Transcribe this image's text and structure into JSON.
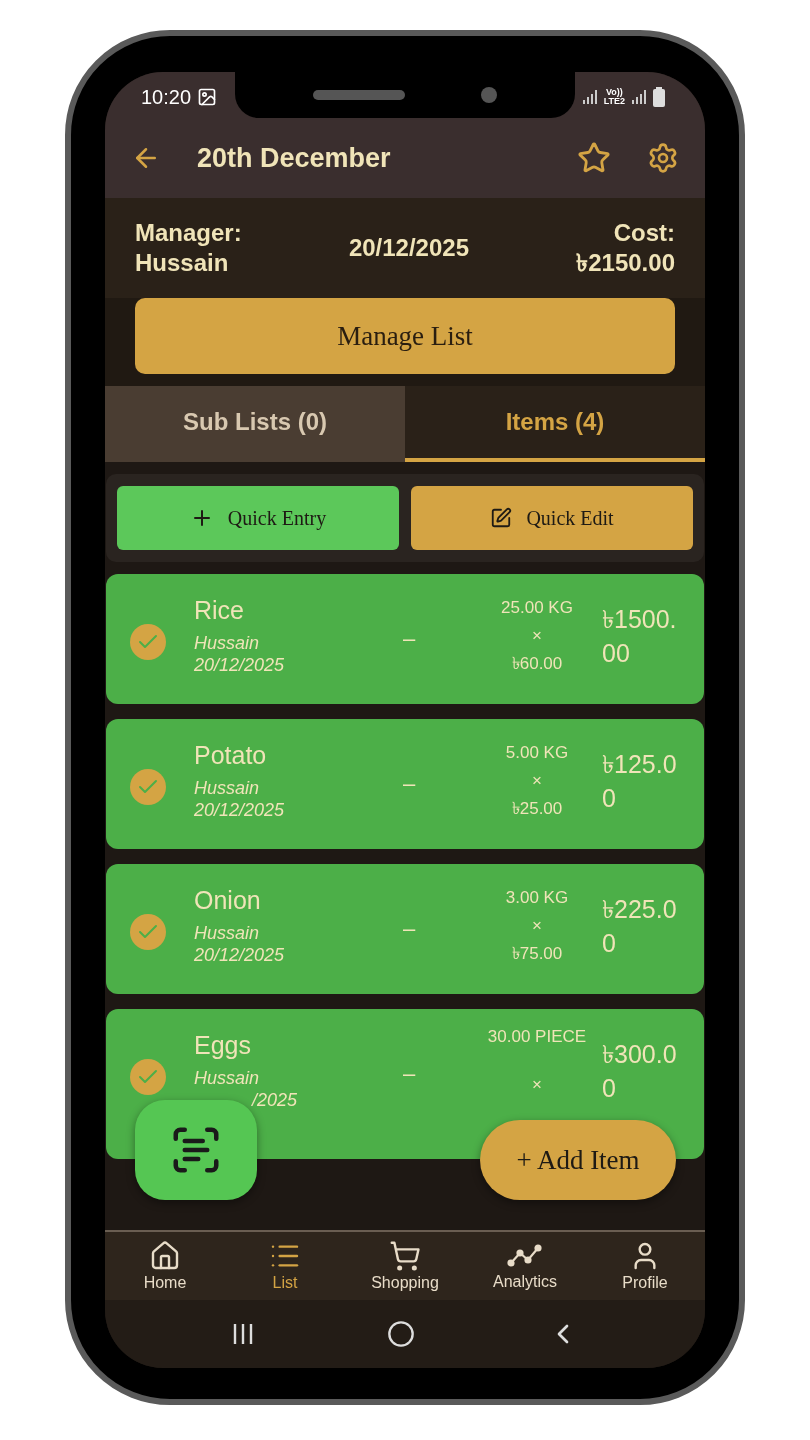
{
  "status_bar": {
    "time": "10:20",
    "network_label": "Vo))",
    "network_type": "LTE2"
  },
  "app_bar": {
    "title": "20th December"
  },
  "summary": {
    "manager_label": "Manager:",
    "manager": "Hussain",
    "date": "20/12/2025",
    "cost_label": "Cost:",
    "cost": "৳2150.00"
  },
  "manage_button": "Manage List",
  "tabs": [
    {
      "label": "Sub Lists (0)",
      "selected": false
    },
    {
      "label": "Items (4)",
      "selected": true
    }
  ],
  "quick_actions": [
    {
      "label": "Quick Entry",
      "kind": "add"
    },
    {
      "label": "Quick Edit",
      "kind": "edit"
    }
  ],
  "items": [
    {
      "name": "Rice",
      "person": "Hussain",
      "date": "20/12/2025",
      "note": "–",
      "quantity": "25.00 KG",
      "times": "×",
      "unit_price": "৳60.00",
      "total": "৳1500.00",
      "checked": true
    },
    {
      "name": "Potato",
      "person": "Hussain",
      "date": "20/12/2025",
      "note": "–",
      "quantity": "5.00 KG",
      "times": "×",
      "unit_price": "৳25.00",
      "total": "৳125.00",
      "checked": true
    },
    {
      "name": "Onion",
      "person": "Hussain",
      "date": "20/12/2025",
      "note": "–",
      "quantity": "3.00 KG",
      "times": "×",
      "unit_price": "৳75.00",
      "total": "৳225.00",
      "checked": true
    },
    {
      "name": "Eggs",
      "person": "Hussain",
      "date": "/2025",
      "note": "–",
      "quantity": "30.00 PIECE",
      "times": "×",
      "total": "৳300.00",
      "checked": true
    }
  ],
  "add_button": "+ Add Item",
  "nav": [
    {
      "label": "Home",
      "selected": false
    },
    {
      "label": "List",
      "selected": true
    },
    {
      "label": "Shopping",
      "selected": false
    },
    {
      "label": "Analytics",
      "selected": false
    },
    {
      "label": "Profile",
      "selected": false
    }
  ]
}
